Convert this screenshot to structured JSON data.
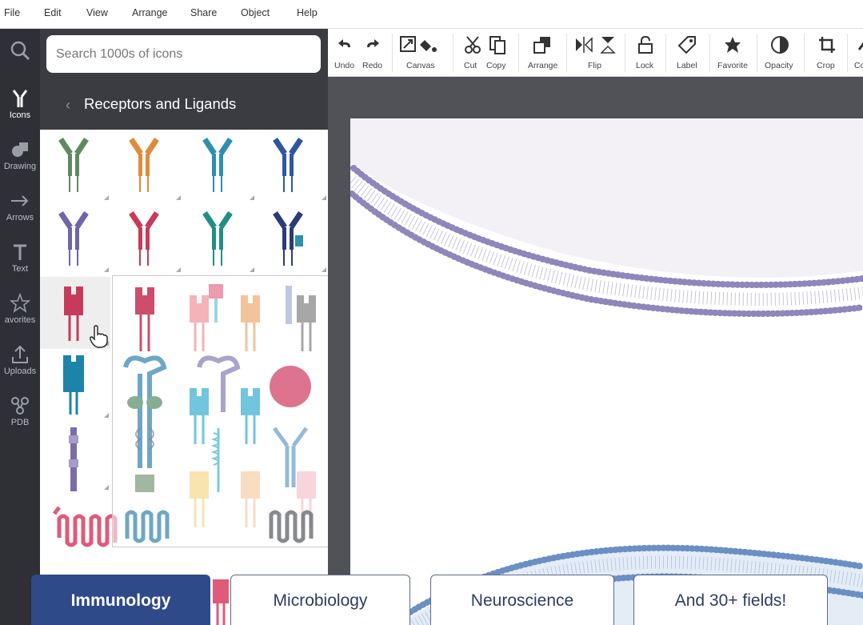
{
  "menu": [
    "File",
    "Edit",
    "View",
    "Arrange",
    "Share",
    "Object",
    "Help"
  ],
  "rail": [
    {
      "label": "Icons",
      "icon": "antibody-icon"
    },
    {
      "label": "Drawing",
      "icon": "shapes-icon"
    },
    {
      "label": "Arrows",
      "icon": "arrow-icon"
    },
    {
      "label": "Text",
      "icon": "text-icon"
    },
    {
      "label": "avorites",
      "icon": "star-icon"
    },
    {
      "label": "Uploads",
      "icon": "upload-icon"
    },
    {
      "label": "PDB",
      "icon": "molecule-icon"
    }
  ],
  "search": {
    "placeholder": "Search 1000s of icons"
  },
  "category": {
    "back": "‹",
    "title": "Receptors and Ligands"
  },
  "toolbar": [
    {
      "label": "Undo",
      "icon": "undo-icon"
    },
    {
      "label": "Redo",
      "icon": "redo-icon"
    },
    {
      "label": "Canvas",
      "icon": "canvas-icon"
    },
    {
      "label": "Cut",
      "icon": "scissors-icon"
    },
    {
      "label": "Copy",
      "icon": "copy-icon"
    },
    {
      "label": "Arrange",
      "icon": "arrange-icon"
    },
    {
      "label": "Flip",
      "icon": "flip-icon"
    },
    {
      "label": "Lock",
      "icon": "lock-icon"
    },
    {
      "label": "Label",
      "icon": "tag-icon"
    },
    {
      "label": "Favorite",
      "icon": "star-icon"
    },
    {
      "label": "Opacity",
      "icon": "opacity-icon"
    },
    {
      "label": "Crop",
      "icon": "crop-icon"
    },
    {
      "label": "Co",
      "icon": "color-icon"
    }
  ],
  "fields": [
    "Immunology",
    "Microbiology",
    "Neuroscience",
    "And 30+ fields!"
  ],
  "colors": {
    "accent": "#2f4a89",
    "membrane": "#8f86bb",
    "membrane2": "#6b8fc4",
    "panel": "#3a3c42",
    "rail": "#2e3035"
  }
}
